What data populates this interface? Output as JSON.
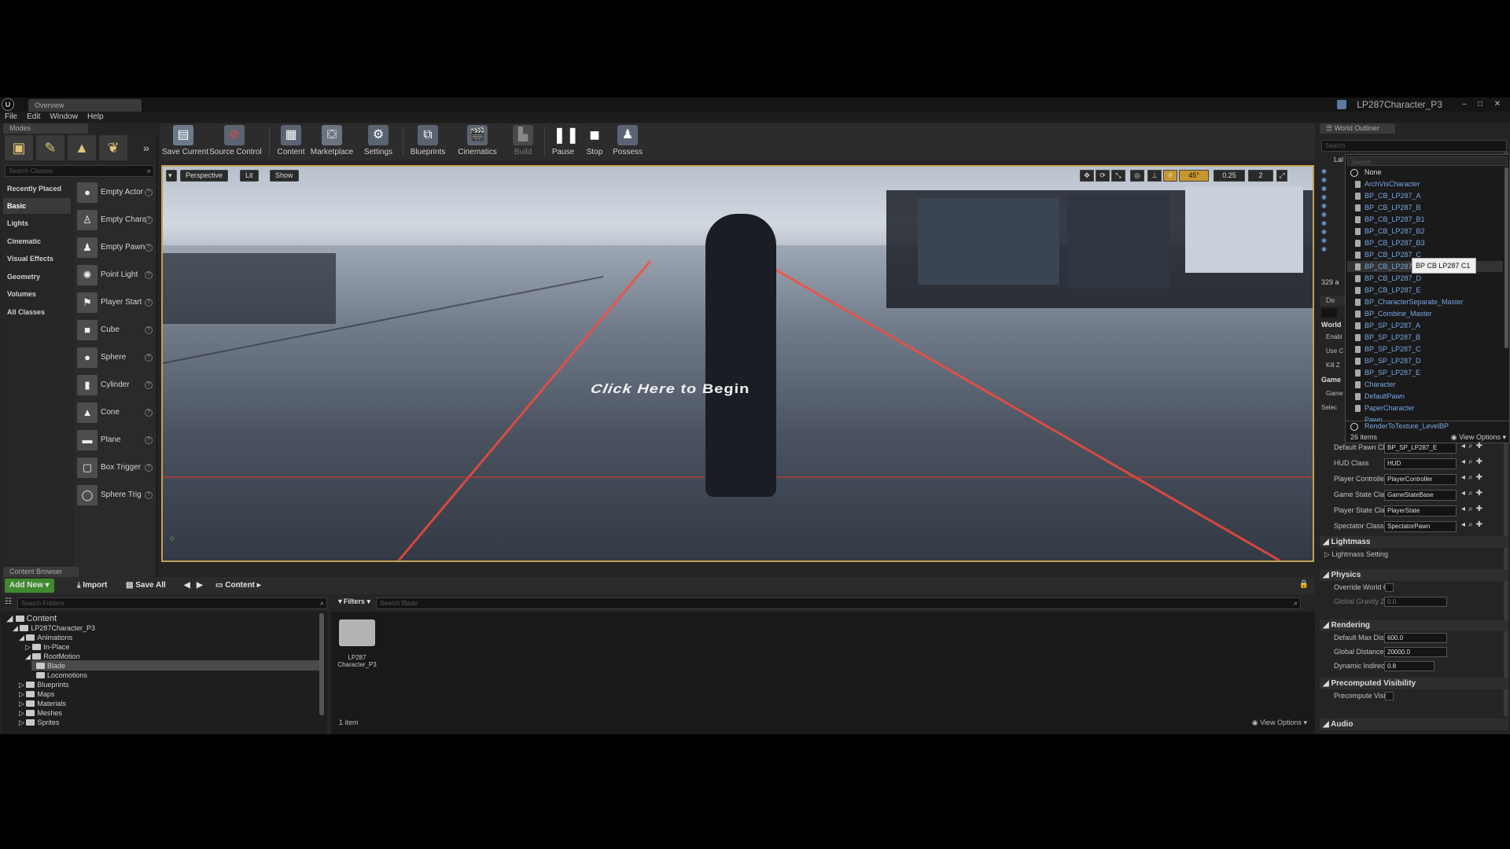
{
  "window": {
    "tab_label": "Overview",
    "project_title": "LP287Character_P3"
  },
  "menu": [
    "File",
    "Edit",
    "Window",
    "Help"
  ],
  "modes": {
    "tab_label": "Modes",
    "search_placeholder": "Search Classes",
    "categories": [
      "Recently Placed",
      "Basic",
      "Lights",
      "Cinematic",
      "Visual Effects",
      "Geometry",
      "Volumes",
      "All Classes"
    ],
    "items": [
      "Empty Actor",
      "Empty Chara",
      "Empty Pawn",
      "Point Light",
      "Player Start",
      "Cube",
      "Sphere",
      "Cylinder",
      "Cone",
      "Plane",
      "Box Trigger",
      "Sphere Trig"
    ]
  },
  "toolbar": {
    "buttons": [
      "Save Current",
      "Source Control",
      "Content",
      "Marketplace",
      "Settings",
      "Blueprints",
      "Cinematics",
      "Build",
      "Pause",
      "Stop",
      "Possess"
    ]
  },
  "viewport": {
    "perspective_label": "Perspective",
    "lit_label": "Lit",
    "show_label": "Show",
    "angle": "45°",
    "scale": "0.25",
    "camera_speed": "2",
    "overlay_text": "Click Here to Begin"
  },
  "content_browser": {
    "tab_label": "Content Browser",
    "add_new": "Add New",
    "import": "Import",
    "save_all": "Save All",
    "path": "Content",
    "folder_search_placeholder": "Search Folders",
    "filters_label": "Filters",
    "asset_search_placeholder": "Search Blade",
    "tree": [
      "Content",
      "LP287Character_P3",
      "Animations",
      "In-Place",
      "RootMotion",
      "Blade",
      "Locomotions",
      "Blueprints",
      "Maps",
      "Materials",
      "Meshes",
      "Sprites"
    ],
    "asset_name_line1": "LP287",
    "asset_name_line2": "Character_P3",
    "item_count": "1 item",
    "view_options": "View Options"
  },
  "outliner": {
    "tab_label": "World Outliner",
    "search_placeholder": "Search",
    "left_label": "Lal",
    "actor_count": "329 a",
    "details_tab": "De",
    "world_label": "World",
    "enable_label": "Enabl",
    "use_label": "Use C",
    "kill_label": "Kill Z",
    "game_label": "Game",
    "game_row": "Game",
    "selected_label": "Selec"
  },
  "class_picker": {
    "search_placeholder": "Search",
    "items": [
      "None",
      "ArchVisCharacter",
      "BP_CB_LP287_A",
      "BP_CB_LP287_B",
      "BP_CB_LP287_B1",
      "BP_CB_LP287_B2",
      "BP_CB_LP287_B3",
      "BP_CB_LP287_C",
      "BP_CB_LP287_C1",
      "BP_CB_LP287_D",
      "BP_CB_LP287_E",
      "BP_CharacterSeparate_Master",
      "BP_Combine_Master",
      "BP_SP_LP287_A",
      "BP_SP_LP287_B",
      "BP_SP_LP287_C",
      "BP_SP_LP287_D",
      "BP_SP_LP287_E",
      "Character",
      "DefaultPawn",
      "PaperCharacter",
      "Pawn",
      "RenderToTexture_LevelBP"
    ],
    "count": "26 items",
    "view_options": "View Options",
    "tooltip": "BP CB LP287 C1"
  },
  "details": {
    "class_rows": [
      {
        "label": "Default Pawn Cl",
        "value": "BP_SP_LP287_E"
      },
      {
        "label": "HUD Class",
        "value": "HUD"
      },
      {
        "label": "Player Controlle",
        "value": "PlayerController"
      },
      {
        "label": "Game State Cla",
        "value": "GameStateBase"
      },
      {
        "label": "Player State Cla",
        "value": "PlayerState"
      },
      {
        "label": "Spectator Class",
        "value": "SpectatorPawn"
      }
    ],
    "lightmass": "Lightmass",
    "lightmass_settings": "Lightmass Setting",
    "physics": "Physics",
    "override_gravity": "Override World Gr",
    "global_gravity": "Global Gravity Z",
    "gravity_value": "0.0",
    "rendering": "Rendering",
    "max_dist_label": "Default Max Dista",
    "max_dist_value": "600.0",
    "global_dist_label": "Global DistanceFie",
    "global_dist_value": "20000.0",
    "dyn_indirect_label": "Dynamic Indirect S",
    "dyn_indirect_value": "0.8",
    "precomputed": "Precomputed Visibility",
    "precompute_label": "Precompute Visibi",
    "audio": "Audio"
  },
  "colors": {
    "accent_viewport_border": "#c2a054",
    "add_new_green": "#3f8a2e",
    "link_blue": "#77a6e4"
  }
}
